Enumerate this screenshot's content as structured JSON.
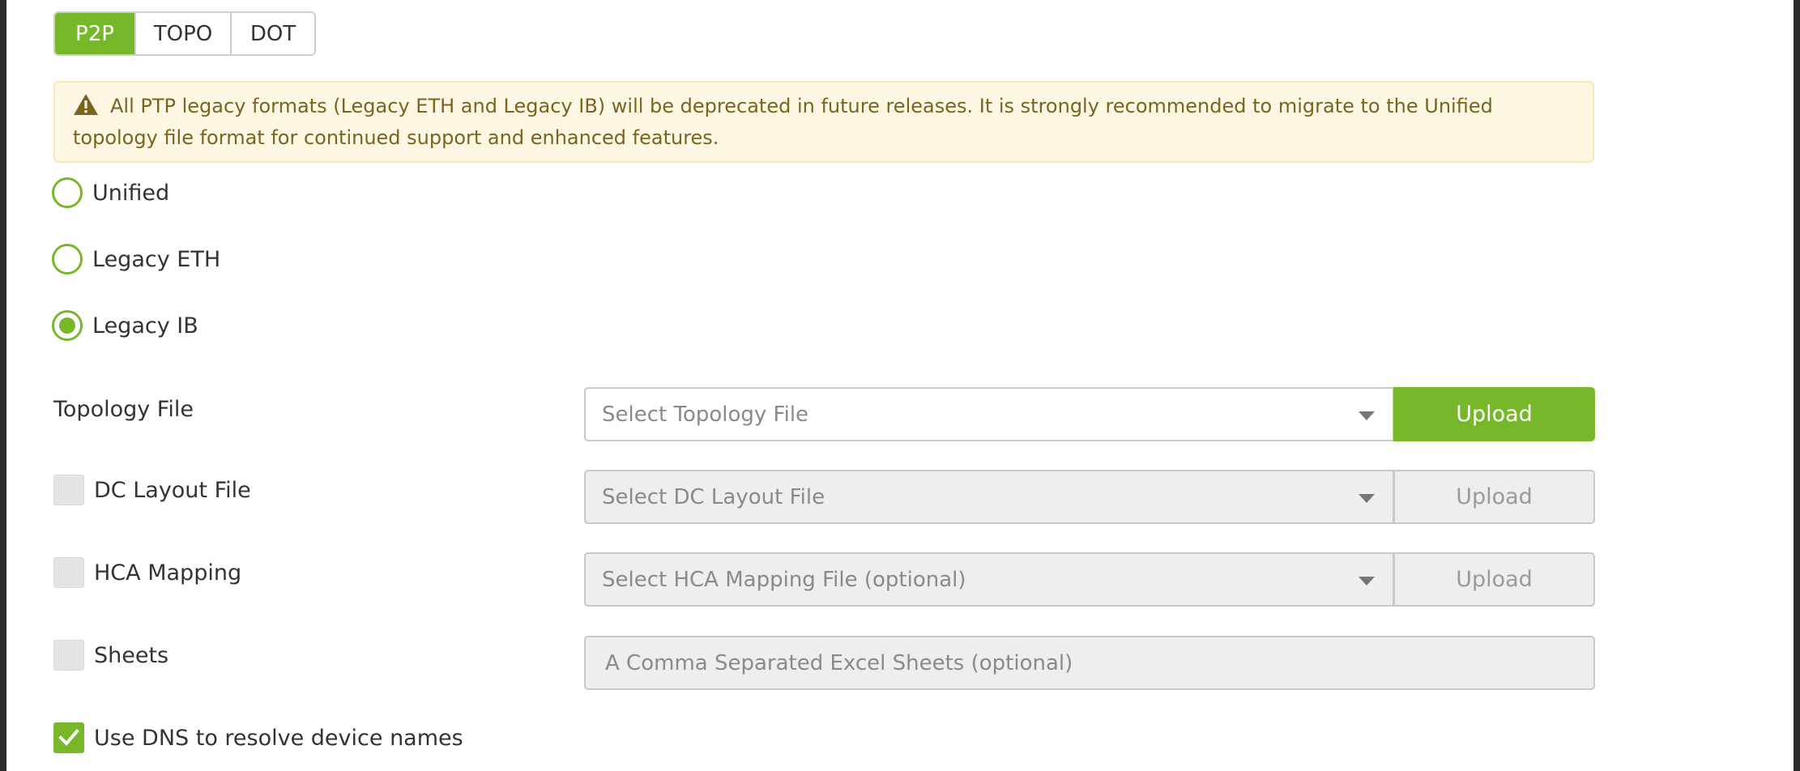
{
  "tabs": [
    {
      "label": "P2P",
      "active": true
    },
    {
      "label": "TOPO",
      "active": false
    },
    {
      "label": "DOT",
      "active": false
    }
  ],
  "alert": {
    "icon": "warning-icon",
    "text": "All PTP legacy formats (Legacy ETH and Legacy IB) will be deprecated in future releases. It is strongly recommended to migrate to the Unified topology file format for continued support and enhanced features."
  },
  "formats": [
    {
      "label": "Unified",
      "selected": false
    },
    {
      "label": "Legacy ETH",
      "selected": false
    },
    {
      "label": "Legacy IB",
      "selected": true
    }
  ],
  "topology": {
    "label": "Topology File",
    "placeholder": "Select Topology File",
    "upload_label": "Upload"
  },
  "dc_layout": {
    "label": "DC Layout File",
    "checked": false,
    "placeholder": "Select DC Layout File",
    "upload_label": "Upload"
  },
  "hca_mapping": {
    "label": "HCA Mapping",
    "checked": false,
    "placeholder": "Select HCA Mapping File (optional)",
    "upload_label": "Upload"
  },
  "sheets": {
    "label": "Sheets",
    "checked": false,
    "placeholder": "A Comma Separated Excel Sheets (optional)"
  },
  "dns": {
    "label": "Use DNS to resolve device names",
    "checked": true
  },
  "colors": {
    "accent": "#76b82a",
    "alert_bg": "#fdf7e3",
    "alert_text": "#7a6420",
    "disabled_bg": "#eeeeee"
  }
}
